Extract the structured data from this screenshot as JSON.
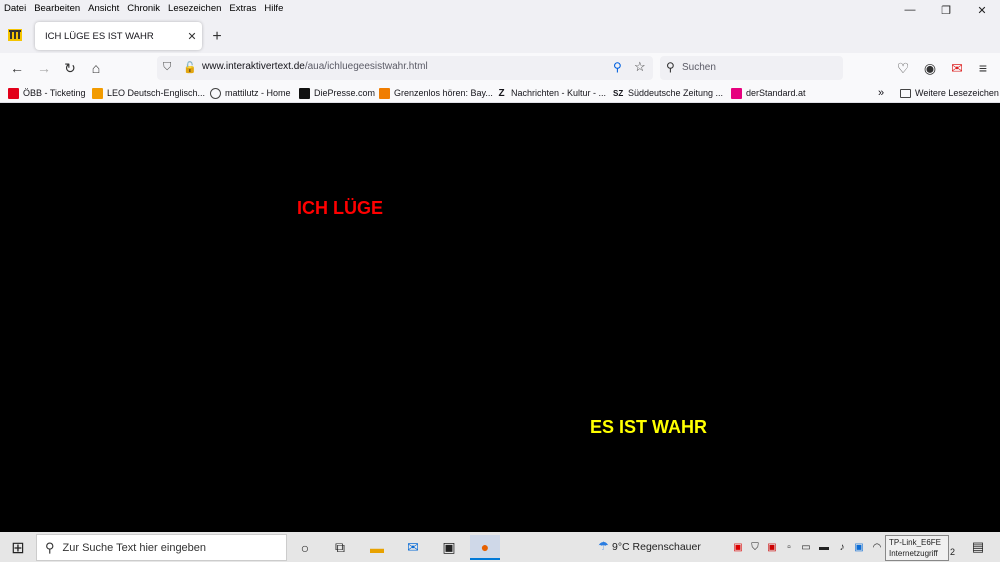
{
  "menu": [
    "Datei",
    "Bearbeiten",
    "Ansicht",
    "Chronik",
    "Lesezeichen",
    "Extras",
    "Hilfe"
  ],
  "tab": {
    "title": "ICH LÜGE ES IST WAHR"
  },
  "urlbar": {
    "host": "www.interaktivertext.de",
    "path": "/aua/ichluegeesistwahr.html"
  },
  "searchbar": {
    "placeholder": "Suchen"
  },
  "bookmarks": [
    "ÖBB - Ticketing",
    "LEO Deutsch-Englisch...",
    "mattilutz - Home",
    "DiePresse.com",
    "Grenzenlos hören: Bay...",
    "Nachrichten - Kultur - ...",
    "Süddeutsche Zeitung ...",
    "derStandard.at"
  ],
  "bookmarks_more": "Weitere Lesezeichen",
  "page": {
    "lie": "ICH LÜGE",
    "truth": "ES IST WAHR"
  },
  "colors": {
    "lie": "#ff0000",
    "truth": "#ffff00",
    "background": "#000000"
  },
  "taskbar": {
    "search_placeholder": "Zur Suche Text hier eingeben",
    "weather": "9°C  Regenschauer",
    "tooltip_line1": "TP-Link_E6FE",
    "tooltip_line2": "Internetzugriff",
    "clock_fragment": "2"
  }
}
